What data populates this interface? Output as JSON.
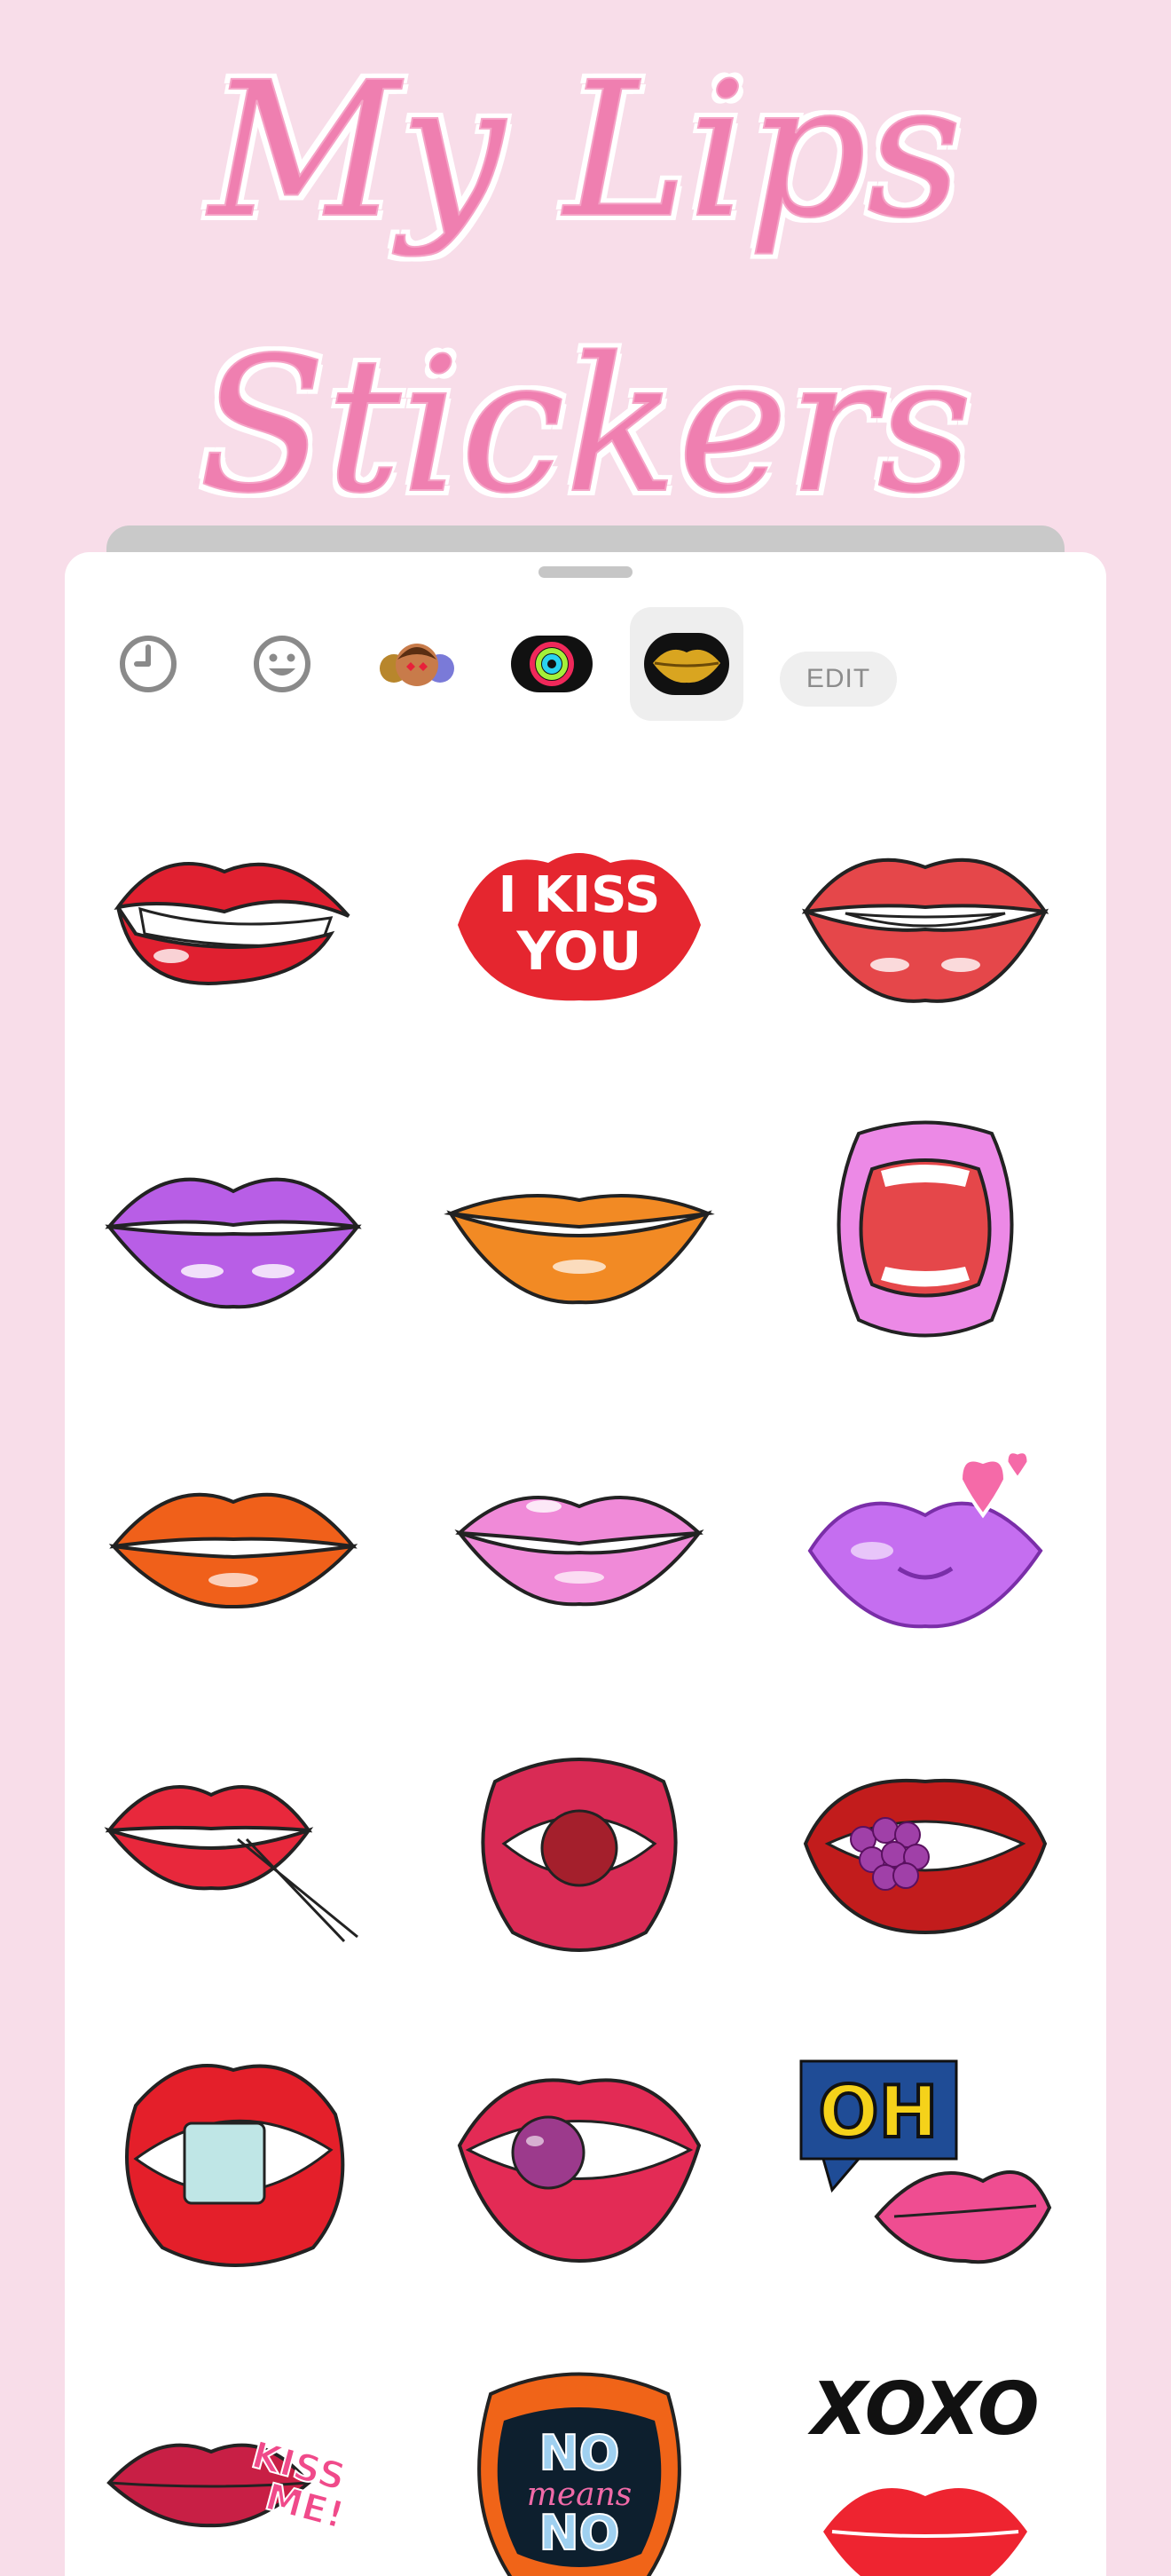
{
  "header": {
    "title_line1": "My Lips",
    "title_line2": "Stickers"
  },
  "toolbar": {
    "items": [
      {
        "icon": "recent-clock-icon"
      },
      {
        "icon": "emoji-smiley-icon"
      },
      {
        "icon": "memoji-icon"
      },
      {
        "icon": "activity-rings-icon"
      },
      {
        "icon": "gold-lips-pack-icon",
        "selected": true
      }
    ],
    "edit_label": "EDIT"
  },
  "stickers": [
    {
      "name": "biting-red-lips",
      "color": "#e02030"
    },
    {
      "name": "i-kiss-you-lips",
      "color": "#e5262f",
      "text1": "I KISS",
      "text2": "YOU"
    },
    {
      "name": "red-smile-lips",
      "color": "#e5474a"
    },
    {
      "name": "purple-lips",
      "color": "#b85ee6"
    },
    {
      "name": "orange-lips",
      "color": "#f28a24"
    },
    {
      "name": "open-mouth-pink-lips",
      "color": "#ec89e6"
    },
    {
      "name": "orange-red-lips",
      "color": "#f0601a"
    },
    {
      "name": "pink-lips",
      "color": "#f08ad8"
    },
    {
      "name": "heart-kiss-lips",
      "color": "#c56ef0"
    },
    {
      "name": "lips-with-toothpick",
      "color": "#e8283c"
    },
    {
      "name": "lips-with-candy",
      "color": "#d92b55"
    },
    {
      "name": "lips-with-berries",
      "color": "#c21c1c"
    },
    {
      "name": "lips-with-ice-cube",
      "color": "#e41f2a"
    },
    {
      "name": "lips-with-purple-candy",
      "color": "#e32b55"
    },
    {
      "name": "oh-kiss-lips",
      "color": "#ef4d91",
      "text": "OH"
    },
    {
      "name": "kiss-me-lips",
      "color": "#c81f45",
      "text1": "KISS",
      "text2": "ME!"
    },
    {
      "name": "no-means-no-lips",
      "color": "#f06418",
      "text1": "NO",
      "text2": "means",
      "text3": "NO"
    },
    {
      "name": "xoxo-lips",
      "color": "#ee2430",
      "text": "XOXO"
    }
  ]
}
